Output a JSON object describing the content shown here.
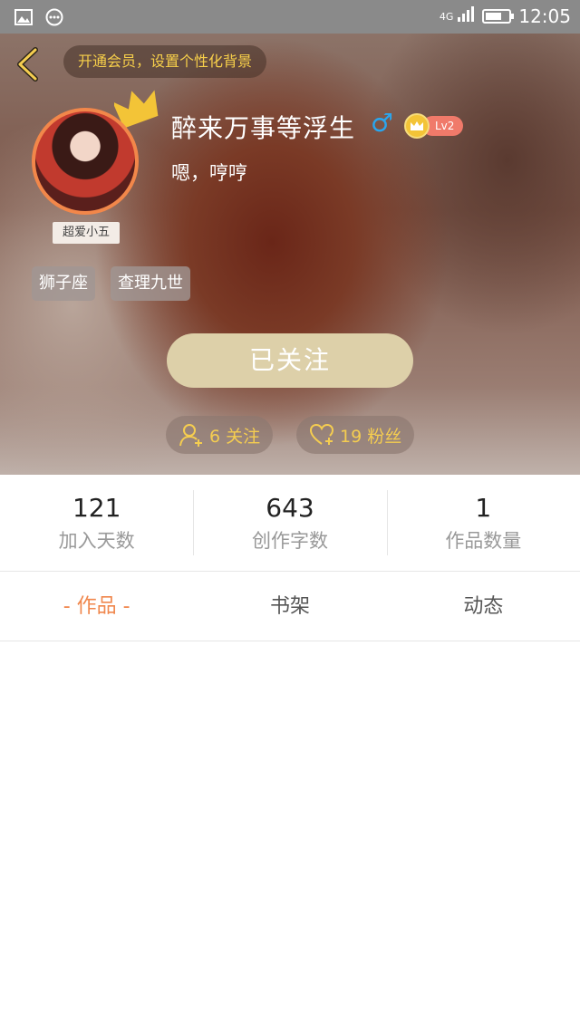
{
  "status_bar": {
    "network": "4G",
    "time": "12:05",
    "icons": [
      "image-icon",
      "more-dots-icon",
      "signal-icon",
      "battery-icon"
    ]
  },
  "header": {
    "vip_banner": "开通会员，设置个性化背景",
    "username": "醉来万事等浮生",
    "gender_symbol": "♂",
    "level": "Lv2",
    "signature": "嗯，哼哼",
    "avatar_tag": "超爱小五",
    "tags": [
      "狮子座",
      "查理九世"
    ],
    "follow_button": "已关注",
    "following": "6 关注",
    "fans": "19 粉丝"
  },
  "stats": [
    {
      "value": "121",
      "label": "加入天数"
    },
    {
      "value": "643",
      "label": "创作字数"
    },
    {
      "value": "1",
      "label": "作品数量"
    }
  ],
  "tabs": [
    {
      "label": "- 作品 -",
      "active": true
    },
    {
      "label": "书架",
      "active": false
    },
    {
      "label": "动态",
      "active": false
    }
  ],
  "colors": {
    "accent_orange": "#f0874d",
    "gold": "#f5cd50",
    "follow_button_bg": "#ddd0a9",
    "gender_blue": "#2aa6ee"
  }
}
